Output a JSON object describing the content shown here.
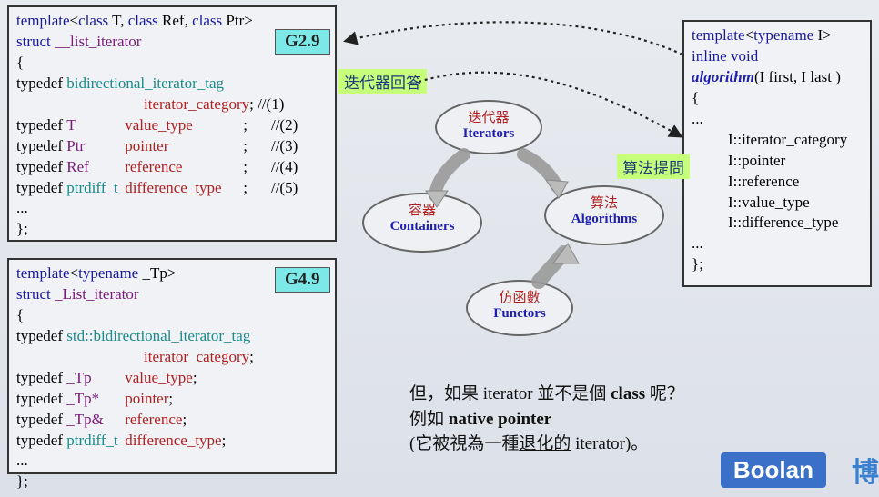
{
  "box1": {
    "badge": "G2.9",
    "l1a": "template",
    "l1b": "<",
    "l1c": "class",
    "l1d": " T, ",
    "l1e": "class",
    "l1f": " Ref, ",
    "l1g": "class",
    "l1h": " Ptr>",
    "l2a": "struct",
    "l2b": "  __list_iterator",
    "l3": "{",
    "l4a": "  typedef ",
    "l4b": "bidirectional_iterator_tag",
    "l5a": "iterator_category",
    "l5b": "; //(1)",
    "r2a": "  typedef ",
    "r2b": "T",
    "r2c": "value_type",
    "r2d": ";",
    "r2e": "//(2)",
    "r3a": "  typedef ",
    "r3b": "Ptr",
    "r3c": "pointer",
    "r3d": ";",
    "r3e": "//(3)",
    "r4a": "  typedef ",
    "r4b": "Ref",
    "r4c": "reference",
    "r4d": ";",
    "r4e": "//(4)",
    "r5a": "  typedef ",
    "r5b": "ptrdiff_t",
    "r5c": "difference_type",
    "r5d": ";",
    "r5e": "//(5)",
    "lend1": "...",
    "lend2": "};"
  },
  "box2": {
    "badge": "G4.9",
    "l1a": "template",
    "l1b": "<",
    "l1c": "typename",
    "l1d": " _Tp>",
    "l2a": "struct",
    "l2b": "  _List_iterator",
    "l3": "{",
    "l4a": "  typedef ",
    "l4b": "std::bidirectional_iterator_tag",
    "l5a": "iterator_category",
    "l5b": ";",
    "r2a": "  typedef ",
    "r2b": "_Tp",
    "r2c": "value_type",
    "r2d": ";",
    "r3a": "  typedef ",
    "r3b": "_Tp*",
    "r3c": "pointer",
    "r3d": ";",
    "r4a": "  typedef ",
    "r4b": "_Tp&",
    "r4c": "reference",
    "r4d": ";",
    "r5a": "  typedef ",
    "r5b": "ptrdiff_t",
    "r5c": "difference_type",
    "r5d": ";",
    "lend1": "...",
    "lend2": "};"
  },
  "box3": {
    "l1a": "template",
    "l1b": "<",
    "l1c": "typename",
    "l1d": " I>",
    "l2a": "inline",
    "l2b": " void",
    "l3a": "algorithm",
    "l3b": "(I first, I last )",
    "l4": "{",
    "l5": "  ...",
    "r1": "I::iterator_category",
    "r2": "I::pointer",
    "r3": "I::reference",
    "r4": "I::value_type",
    "r5": "I::difference_type",
    "lend1": "  ...",
    "lend2": "};"
  },
  "labels": {
    "answer": "迭代器回答",
    "ask": "算法提問"
  },
  "bubbles": {
    "iter_cn": "迭代器",
    "iter_en": "Iterators",
    "cont_cn": "容器",
    "cont_en": "Containers",
    "algo_cn": "算法",
    "algo_en": "Algorithms",
    "func_cn": "仿函數",
    "func_en": "Functors"
  },
  "question": {
    "l1a": "但，如果 iterator 並不是個 ",
    "l1b": "class",
    "l1c": " 呢？",
    "l2a": "例如 ",
    "l2b": "native pointer",
    "l3a": "(它被視為一種",
    "l3b": "退化的",
    "l3c": " iterator)。"
  },
  "brand": {
    "logo": "Boolan",
    "logo2": "博"
  }
}
